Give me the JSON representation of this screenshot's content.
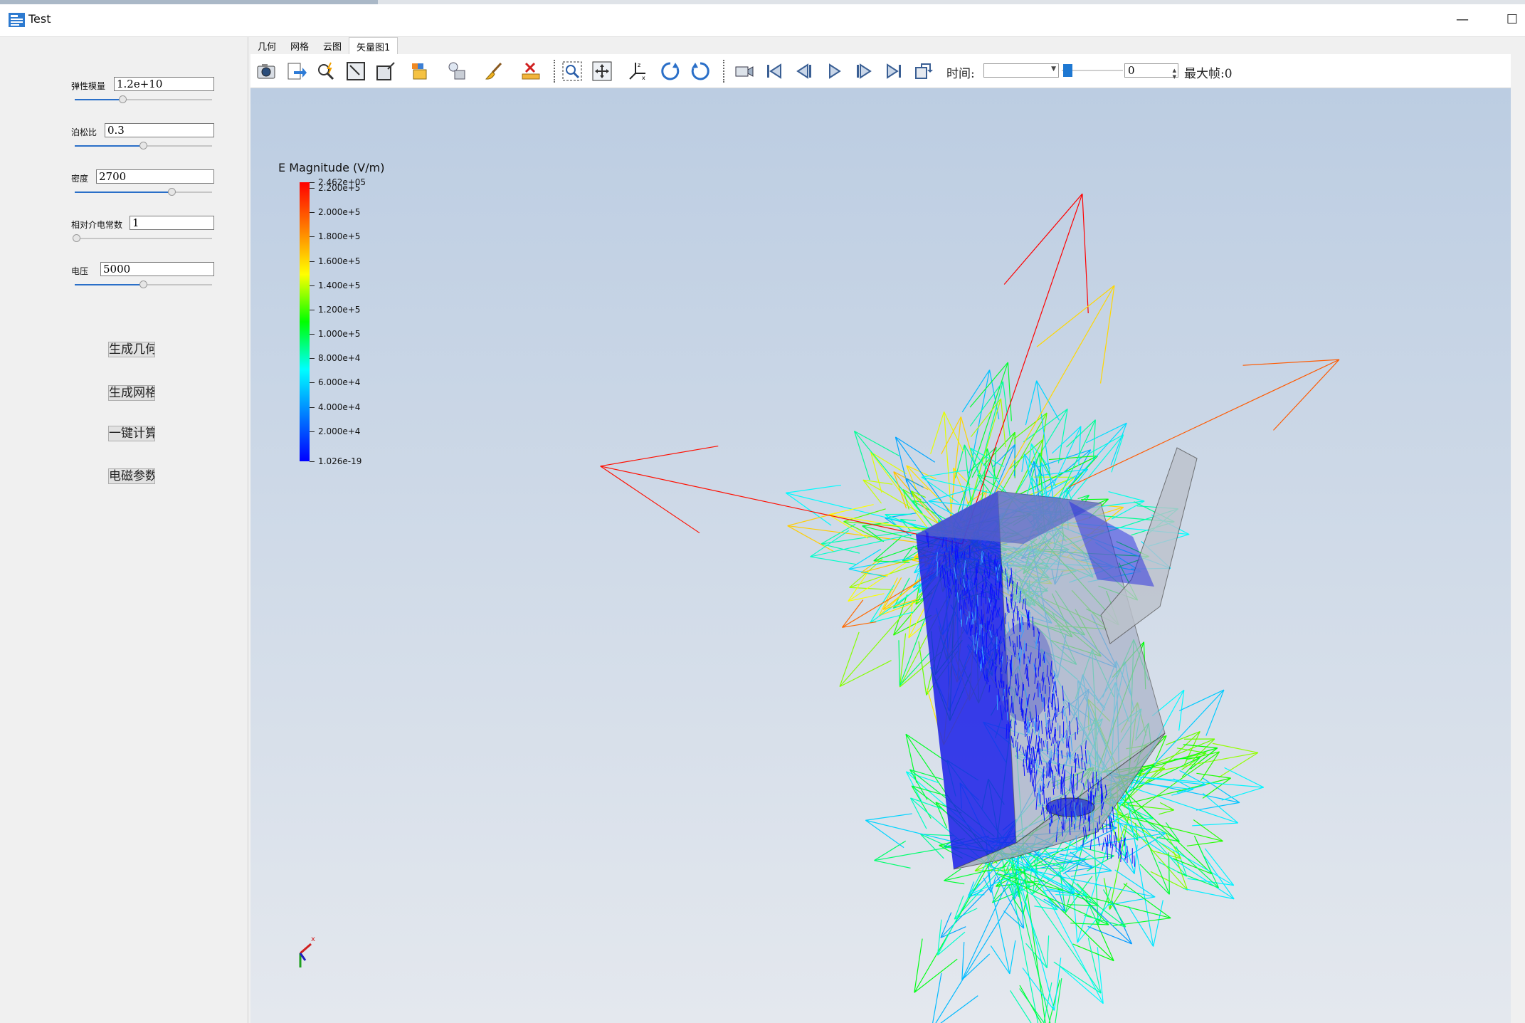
{
  "window": {
    "title": "Test",
    "minimize_glyph": "—",
    "maximize_glyph": "☐"
  },
  "params": [
    {
      "label": "弹性模量",
      "value": "1.2e+10",
      "slider_fraction": 0.35
    },
    {
      "label": "泊松比",
      "value": "0.3",
      "slider_fraction": 0.5
    },
    {
      "label": "密度",
      "value": "2700",
      "slider_fraction": 0.7
    },
    {
      "label": "相对介电常数",
      "value": "1",
      "slider_fraction": 0.0
    },
    {
      "label": "电压",
      "value": "5000",
      "slider_fraction": 0.5
    }
  ],
  "buttons": {
    "gen_geometry": "生成几何",
    "gen_mesh": "生成网格",
    "compute": "一键计算",
    "em_params": "电磁参数"
  },
  "tabs": [
    {
      "label": "几何",
      "active": false
    },
    {
      "label": "网格",
      "active": false
    },
    {
      "label": "云图",
      "active": false
    },
    {
      "label": "矢量图1",
      "active": true
    }
  ],
  "toolbar": {
    "time_label": "时间:",
    "time_value": "",
    "frame_value": "0",
    "max_frame_label": "最大帧:0",
    "icons": [
      "camera-icon",
      "export-icon",
      "probe-icon",
      "fit-view-icon",
      "frame-box-icon",
      "color-box-icon",
      "bulb-icon",
      "box-view-icon",
      "brush-icon",
      "ruler-icon",
      "zoom-box-icon",
      "pan-icon",
      "axes-icon",
      "rotate-cw-icon",
      "rotate-ccw-icon",
      "video-camera-icon",
      "first-frame-icon",
      "prev-frame-icon",
      "play-icon",
      "next-frame-icon",
      "last-frame-icon",
      "loop-icon"
    ]
  },
  "legend": {
    "title": "E Magnitude (V/m)",
    "labels": [
      "2.462e+05",
      "2.200e+5",
      "2.000e+5",
      "1.800e+5",
      "1.600e+5",
      "1.400e+5",
      "1.200e+5",
      "1.000e+5",
      "8.000e+4",
      "6.000e+4",
      "4.000e+4",
      "2.000e+4",
      "1.026e-19"
    ],
    "colors": {
      "max": "#ff0000",
      "mid": "#00ff00",
      "min": "#0000ff"
    }
  },
  "viewport": {
    "background_top": "#bccde2",
    "background_bottom": "#e4e8ee"
  }
}
